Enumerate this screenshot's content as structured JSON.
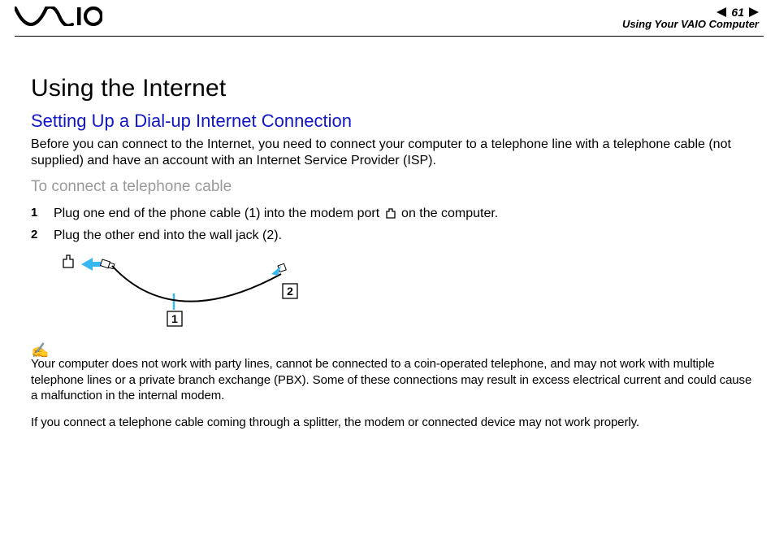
{
  "header": {
    "page_number": "61",
    "breadcrumb": "Using Your VAIO Computer"
  },
  "content": {
    "h1": "Using the Internet",
    "h2": "Setting Up a Dial-up Internet Connection",
    "intro": "Before you can connect to the Internet, you need to connect your computer to a telephone line with a telephone cable (not supplied) and have an account with an Internet Service Provider (ISP).",
    "h3": "To connect a telephone cable",
    "steps": {
      "s1_a": "Plug one end of the phone cable (1) into the modem port ",
      "s1_b": " on the computer.",
      "s2": "Plug the other end into the wall jack (2)."
    },
    "diagram": {
      "label1": "1",
      "label2": "2"
    },
    "note1": "Your computer does not work with party lines, cannot be connected to a coin-operated telephone, and may not work with multiple telephone lines or a private branch exchange (PBX). Some of these connections may result in excess electrical current and could cause a malfunction in the internal modem.",
    "note2": "If you connect a telephone cable coming through a splitter, the modem or connected device may not work properly."
  }
}
